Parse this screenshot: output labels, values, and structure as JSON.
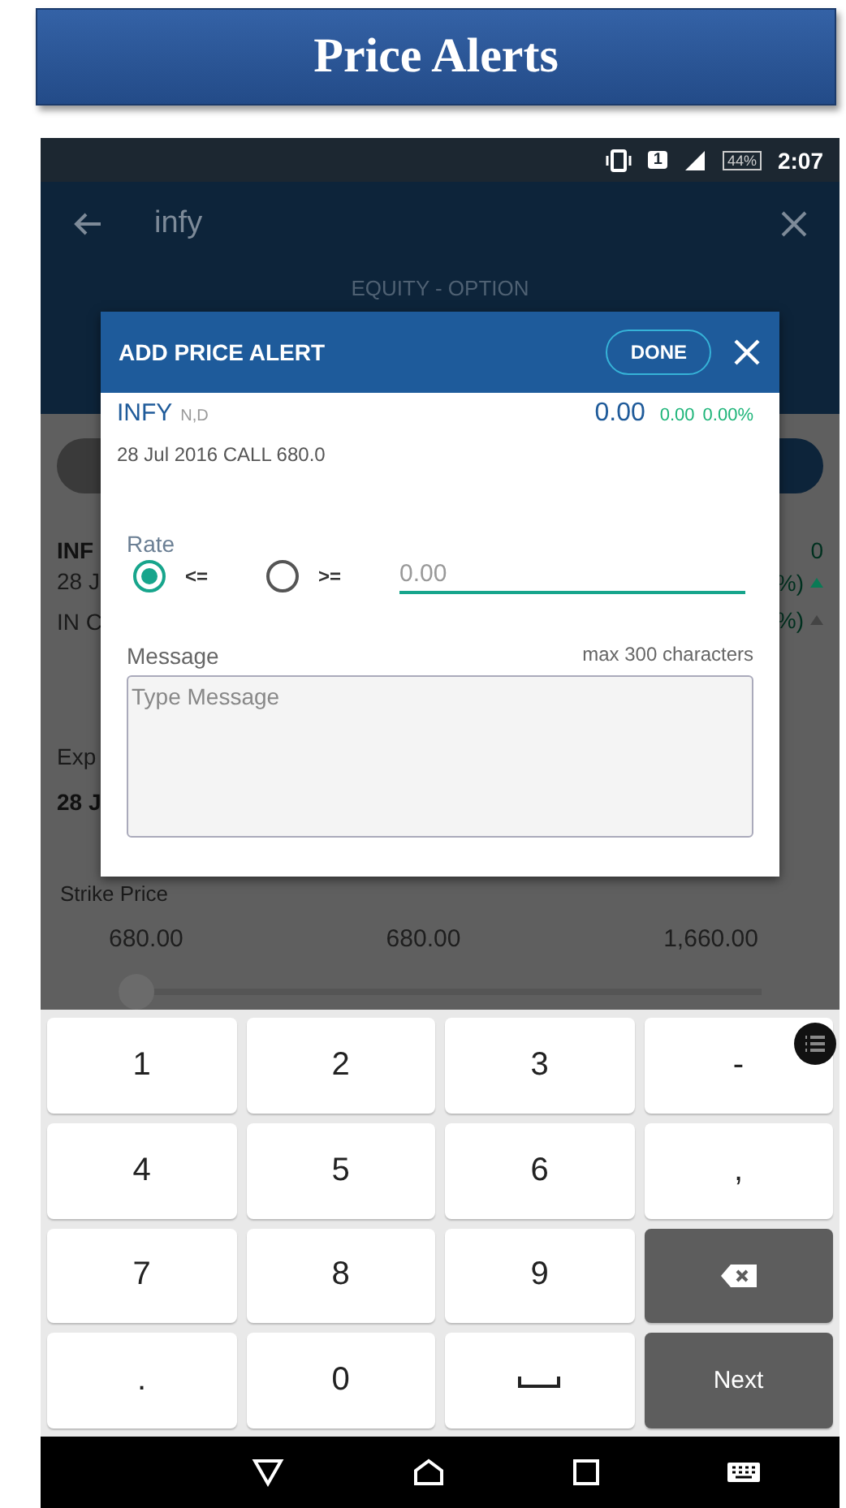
{
  "banner": {
    "title": "Price Alerts"
  },
  "status_bar": {
    "sim": "1",
    "battery": "44%",
    "time": "2:07"
  },
  "app_bar": {
    "search": "infy",
    "segment": "EQUITY - OPTION"
  },
  "background": {
    "left_fragments": [
      "INF",
      "28 J",
      "IN C",
      "Exp",
      "28 J"
    ],
    "right_fragments": [
      "0",
      "%)",
      "%)"
    ],
    "strike_label": "Strike Price",
    "strike_values": [
      "680.00",
      "680.00",
      "1,660.00"
    ],
    "slider": {
      "level": 0
    }
  },
  "dialog": {
    "title": "ADD PRICE ALERT",
    "done": "DONE",
    "symbol": "INFY",
    "exchange": "N,D",
    "price": "0.00",
    "change": "0.00",
    "change_pct": "0.00%",
    "contract": "28 Jul 2016 CALL 680.0",
    "rate_label": "Rate",
    "rate_options": [
      {
        "label": "<=",
        "selected": true
      },
      {
        "label": ">=",
        "selected": false
      }
    ],
    "rate_placeholder": "0.00",
    "message_label": "Message",
    "message_hint": "max 300 characters",
    "message_placeholder": "Type Message"
  },
  "keyboard": {
    "rows": [
      [
        {
          "kind": "key",
          "label": "1"
        },
        {
          "kind": "key",
          "label": "2"
        },
        {
          "kind": "key",
          "label": "3"
        },
        {
          "kind": "key",
          "label": "-"
        }
      ],
      [
        {
          "kind": "key",
          "label": "4"
        },
        {
          "kind": "key",
          "label": "5"
        },
        {
          "kind": "key",
          "label": "6"
        },
        {
          "kind": "key",
          "label": ","
        }
      ],
      [
        {
          "kind": "key",
          "label": "7"
        },
        {
          "kind": "key",
          "label": "8"
        },
        {
          "kind": "key",
          "label": "9"
        },
        {
          "kind": "backspace"
        }
      ],
      [
        {
          "kind": "key",
          "label": "."
        },
        {
          "kind": "key",
          "label": "0"
        },
        {
          "kind": "space"
        },
        {
          "kind": "action",
          "label": "Next"
        }
      ]
    ]
  }
}
